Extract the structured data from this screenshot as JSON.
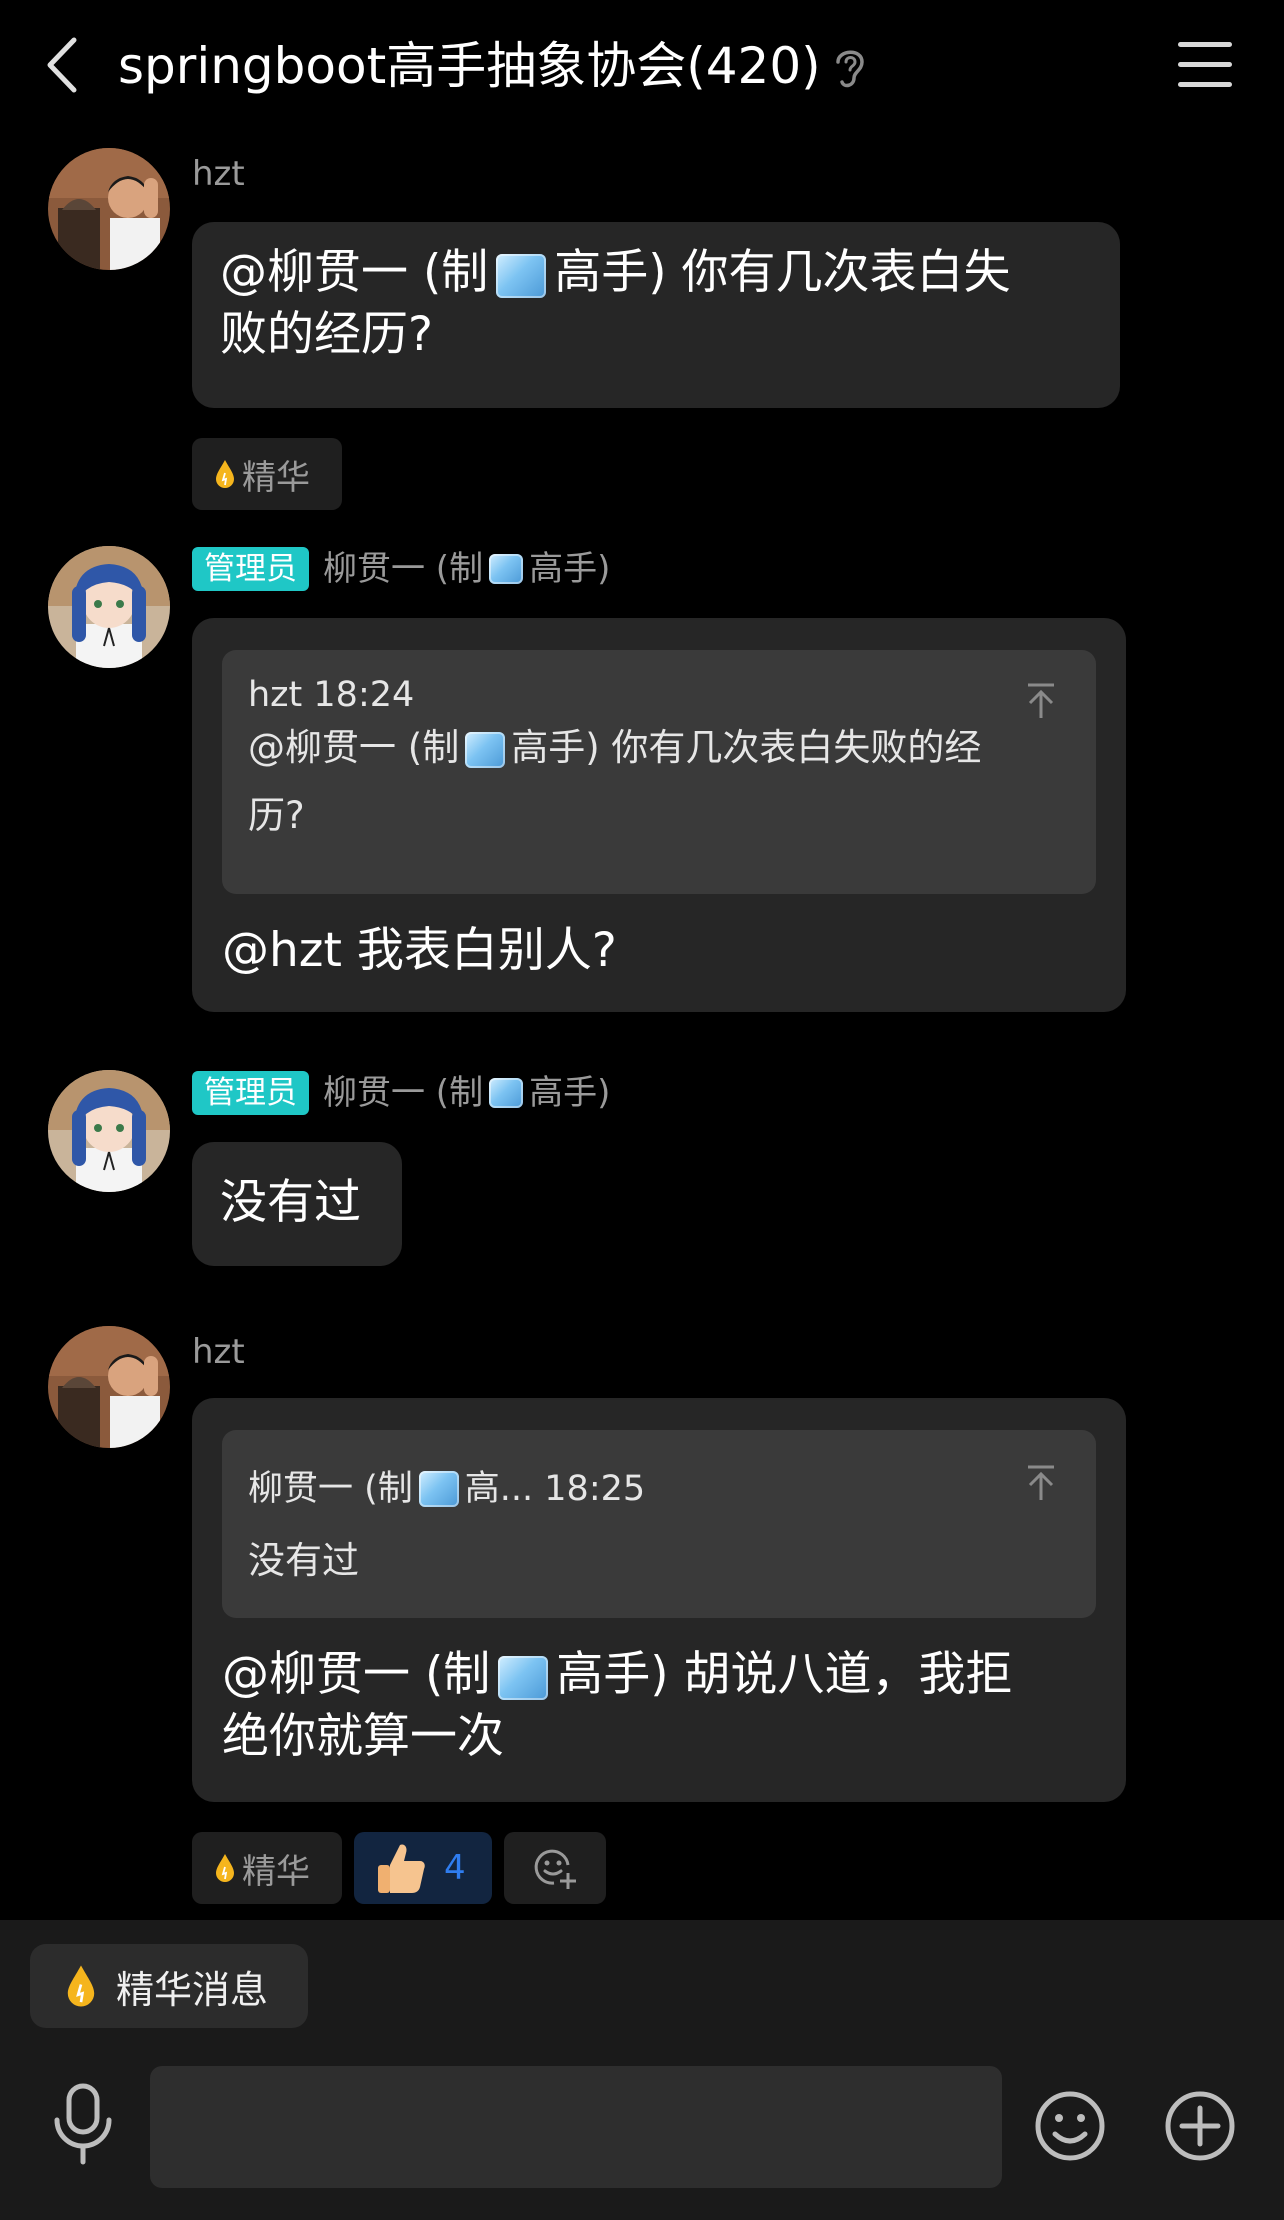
{
  "header": {
    "title": "springboot高手抽象协会(420)"
  },
  "icons": {
    "back": "chevron-left-icon",
    "ear": "ear-icon",
    "menu": "hamburger-menu-icon",
    "pin": "arrow-up-to-top-icon",
    "essence": "drop-icon",
    "mic": "microphone-icon",
    "emoji": "smiley-icon",
    "plus": "plus-circle-icon",
    "add_reaction": "add-emoji-icon",
    "thumbs_up": "thumbs-up-emoji"
  },
  "colors": {
    "background": "#000000",
    "bubble": "#262626",
    "quote": "#3a3a3a",
    "admin_badge": "#1fc7c6",
    "like_text": "#2f7df0",
    "essence_drop": "#f5b51d"
  },
  "messages": [
    {
      "sender": "hzt",
      "text_a": "@柳贯一 (制",
      "text_b": "高手) 你有几次表白失",
      "text_c": "败的经历?",
      "chip_essence": "精华"
    },
    {
      "badge": "管理员",
      "sender_a": "柳贯一 (制",
      "sender_b": "高手)",
      "quote_head": "hzt 18:24",
      "quote_a": "@柳贯一 (制",
      "quote_b": "高手)  你有几次表白失败的经",
      "quote_c": "历?",
      "text": "@hzt 我表白别人?"
    },
    {
      "badge": "管理员",
      "sender_a": "柳贯一 (制",
      "sender_b": "高手)",
      "text": "没有过"
    },
    {
      "sender": "hzt",
      "quote_head_a": "柳贯一 (制",
      "quote_head_b": "高... 18:25",
      "quote_body": "没有过",
      "text_a": "@柳贯一 (制",
      "text_b": "高手) 胡说八道，我拒",
      "text_c": "绝你就算一次",
      "chip_essence": "精华",
      "like_count": "4"
    }
  ],
  "bottom": {
    "essence_button": "精华消息",
    "input_value": ""
  }
}
